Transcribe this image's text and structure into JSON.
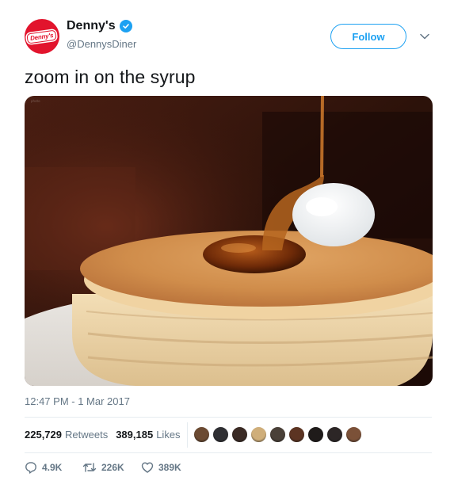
{
  "account": {
    "display_name": "Denny's",
    "handle": "@DennysDiner",
    "avatar_logo_text": "Denny's",
    "brand_color": "#e2142d",
    "verified": true
  },
  "follow_button": {
    "label": "Follow"
  },
  "more_menu_icon": "chevron-down-icon",
  "tweet": {
    "text": "zoom in on the syrup",
    "timestamp": "12:47 PM - 1 Mar 2017"
  },
  "stats": {
    "retweets_count": "225,729",
    "retweets_label": "Retweets",
    "likes_count": "389,185",
    "likes_label": "Likes"
  },
  "likers": [
    "#6b4a32",
    "#2f2f33",
    "#3a2a24",
    "#cfae7a",
    "#4a4038",
    "#5c3422",
    "#1f1b1a",
    "#2c2626",
    "#7b5138"
  ],
  "actions": {
    "reply_count": "4.9K",
    "retweet_count": "226K",
    "like_count": "389K"
  },
  "colors": {
    "accent": "#1da1f2",
    "text_primary": "#14171a",
    "text_secondary": "#657786",
    "divider": "#e6ecf0"
  }
}
